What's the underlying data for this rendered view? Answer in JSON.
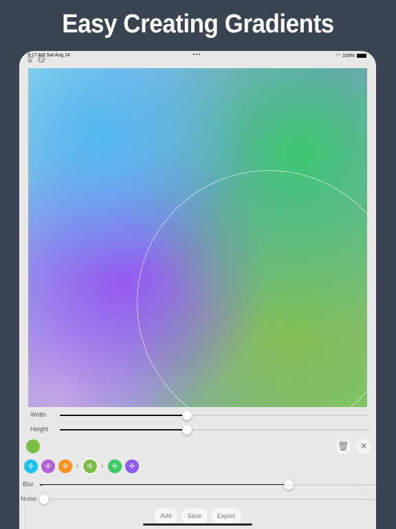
{
  "headline": "Easy Creating Gradients",
  "status_bar": {
    "time": "9:17 AM  Sat Aug 24",
    "battery": "100%"
  },
  "icons": {
    "crown": "crown-icon",
    "settings": "gear-icon",
    "delete": "trash-icon",
    "close": "close-icon",
    "move": "move-icon"
  },
  "sliders": {
    "width": {
      "label": "Width",
      "value": 0.41
    },
    "height": {
      "label": "Height",
      "value": 0.41
    },
    "blur": {
      "label": "Blur",
      "value": 0.74
    },
    "noise": {
      "label": "Noise",
      "value": 0.0
    }
  },
  "colors": {
    "current": "#7cbd45",
    "stops": [
      "#19c2ec",
      "#b45fd8",
      "#f7931e",
      "#7cbd45",
      "#3ccb62",
      "#8f58ee"
    ]
  },
  "selected_stop_index": 3,
  "buttons": {
    "add": "Add",
    "save": "Save",
    "export": "Export"
  }
}
